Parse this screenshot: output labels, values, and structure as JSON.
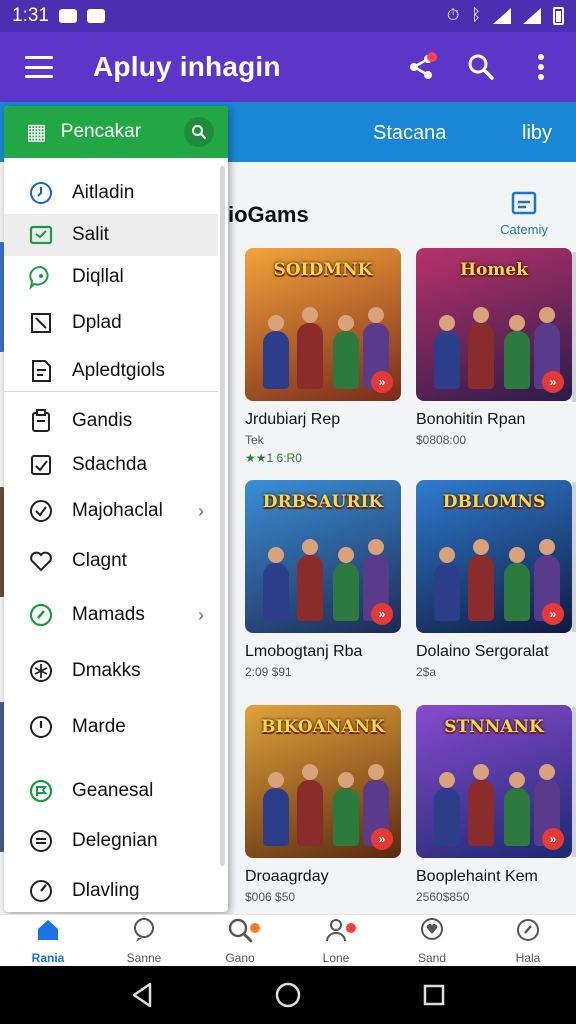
{
  "status_bar": {
    "time": "1:31"
  },
  "app_bar": {
    "title": "Apluy inhagin",
    "actions": [
      "share-icon",
      "search-icon",
      "more-vert-icon"
    ]
  },
  "tabs": [
    "Stacana",
    "liby"
  ],
  "drawer": {
    "header_title": "Pencakar",
    "items": [
      {
        "label": "Aitladin",
        "icon": "clock-icon",
        "active": false,
        "chevron": false
      },
      {
        "label": "Salit",
        "icon": "tablet-icon",
        "active": true,
        "chevron": false
      },
      {
        "label": "Diqllal",
        "icon": "chat-bubble-icon",
        "active": false,
        "chevron": false
      },
      {
        "label": "Dplad",
        "icon": "crop-icon",
        "active": false,
        "chevron": false
      },
      {
        "label": "Apledtgiols",
        "icon": "document-icon",
        "active": false,
        "chevron": false
      },
      {
        "label": "Gandis",
        "icon": "clipboard-icon",
        "active": false,
        "chevron": false
      },
      {
        "label": "Sdachda",
        "icon": "image-icon",
        "active": false,
        "chevron": false
      },
      {
        "label": "Majohaclal",
        "icon": "check-circle-icon",
        "active": false,
        "chevron": true
      },
      {
        "label": "Clagnt",
        "icon": "heart-icon",
        "active": false,
        "chevron": false
      },
      {
        "label": "Mamads",
        "icon": "compass-icon",
        "active": false,
        "chevron": true
      },
      {
        "label": "Dmakks",
        "icon": "pinwheel-icon",
        "active": false,
        "chevron": false
      },
      {
        "label": "Marde",
        "icon": "timer-icon",
        "active": false,
        "chevron": false
      },
      {
        "label": "Geanesal",
        "icon": "flag-circle-icon",
        "active": false,
        "chevron": false
      },
      {
        "label": "Delegnian",
        "icon": "list-circle-icon",
        "active": false,
        "chevron": false
      },
      {
        "label": "Dlavling",
        "icon": "gauge-icon",
        "active": false,
        "chevron": false
      }
    ]
  },
  "content": {
    "section_title": "ioGams",
    "category_link_label": "Catemiy",
    "cards": [
      {
        "art_title": "SOIDMNK",
        "name": "Jrdubiarj Rep",
        "sub": "Tek",
        "rating": "★★1 6:R0",
        "colors": [
          "#f2a33a",
          "#7a2a1a"
        ]
      },
      {
        "art_title": "Homek",
        "name": "Bonohitin Rpan",
        "sub": "$0808:00",
        "rating": "",
        "colors": [
          "#b8326a",
          "#2b1b4a"
        ]
      },
      {
        "art_title": "DRBSAURIK",
        "name": "Lmobogtanj Rba",
        "sub": "2:09 $91",
        "rating": "",
        "colors": [
          "#3a8fd6",
          "#1e2a55"
        ]
      },
      {
        "art_title": "DBLOMNS",
        "name": "Dolaino Sergoralat",
        "sub": "2$a",
        "rating": "",
        "colors": [
          "#2f7cd0",
          "#101a40"
        ]
      },
      {
        "art_title": "BIKOANANK",
        "name": "Droaagrday",
        "sub": "$006 $50",
        "rating": "",
        "colors": [
          "#e0a23a",
          "#5a2a10"
        ]
      },
      {
        "art_title": "STNNANK",
        "name": "Booplehaint Kem",
        "sub": "2560$850",
        "rating": "",
        "colors": [
          "#8a4ad0",
          "#1a2a70"
        ]
      }
    ]
  },
  "bottom_nav": [
    {
      "label": "Rania",
      "icon": "home-icon",
      "active": true,
      "dot": ""
    },
    {
      "label": "Sanne",
      "icon": "chat-icon",
      "active": false,
      "dot": ""
    },
    {
      "label": "Gano",
      "icon": "search-icon",
      "active": false,
      "dot": "#ff7a1a"
    },
    {
      "label": "Lone",
      "icon": "person-icon",
      "active": false,
      "dot": "#ff3d3d"
    },
    {
      "label": "Sand",
      "icon": "heart-pin-icon",
      "active": false,
      "dot": ""
    },
    {
      "label": "Hala",
      "icon": "compass-icon",
      "active": false,
      "dot": ""
    }
  ],
  "colors": {
    "primary": "#5b36c8",
    "status": "#4a2fb0",
    "tab_strip": "#1a86d6",
    "drawer_header": "#22a745",
    "accent_blue": "#1a73e8"
  }
}
